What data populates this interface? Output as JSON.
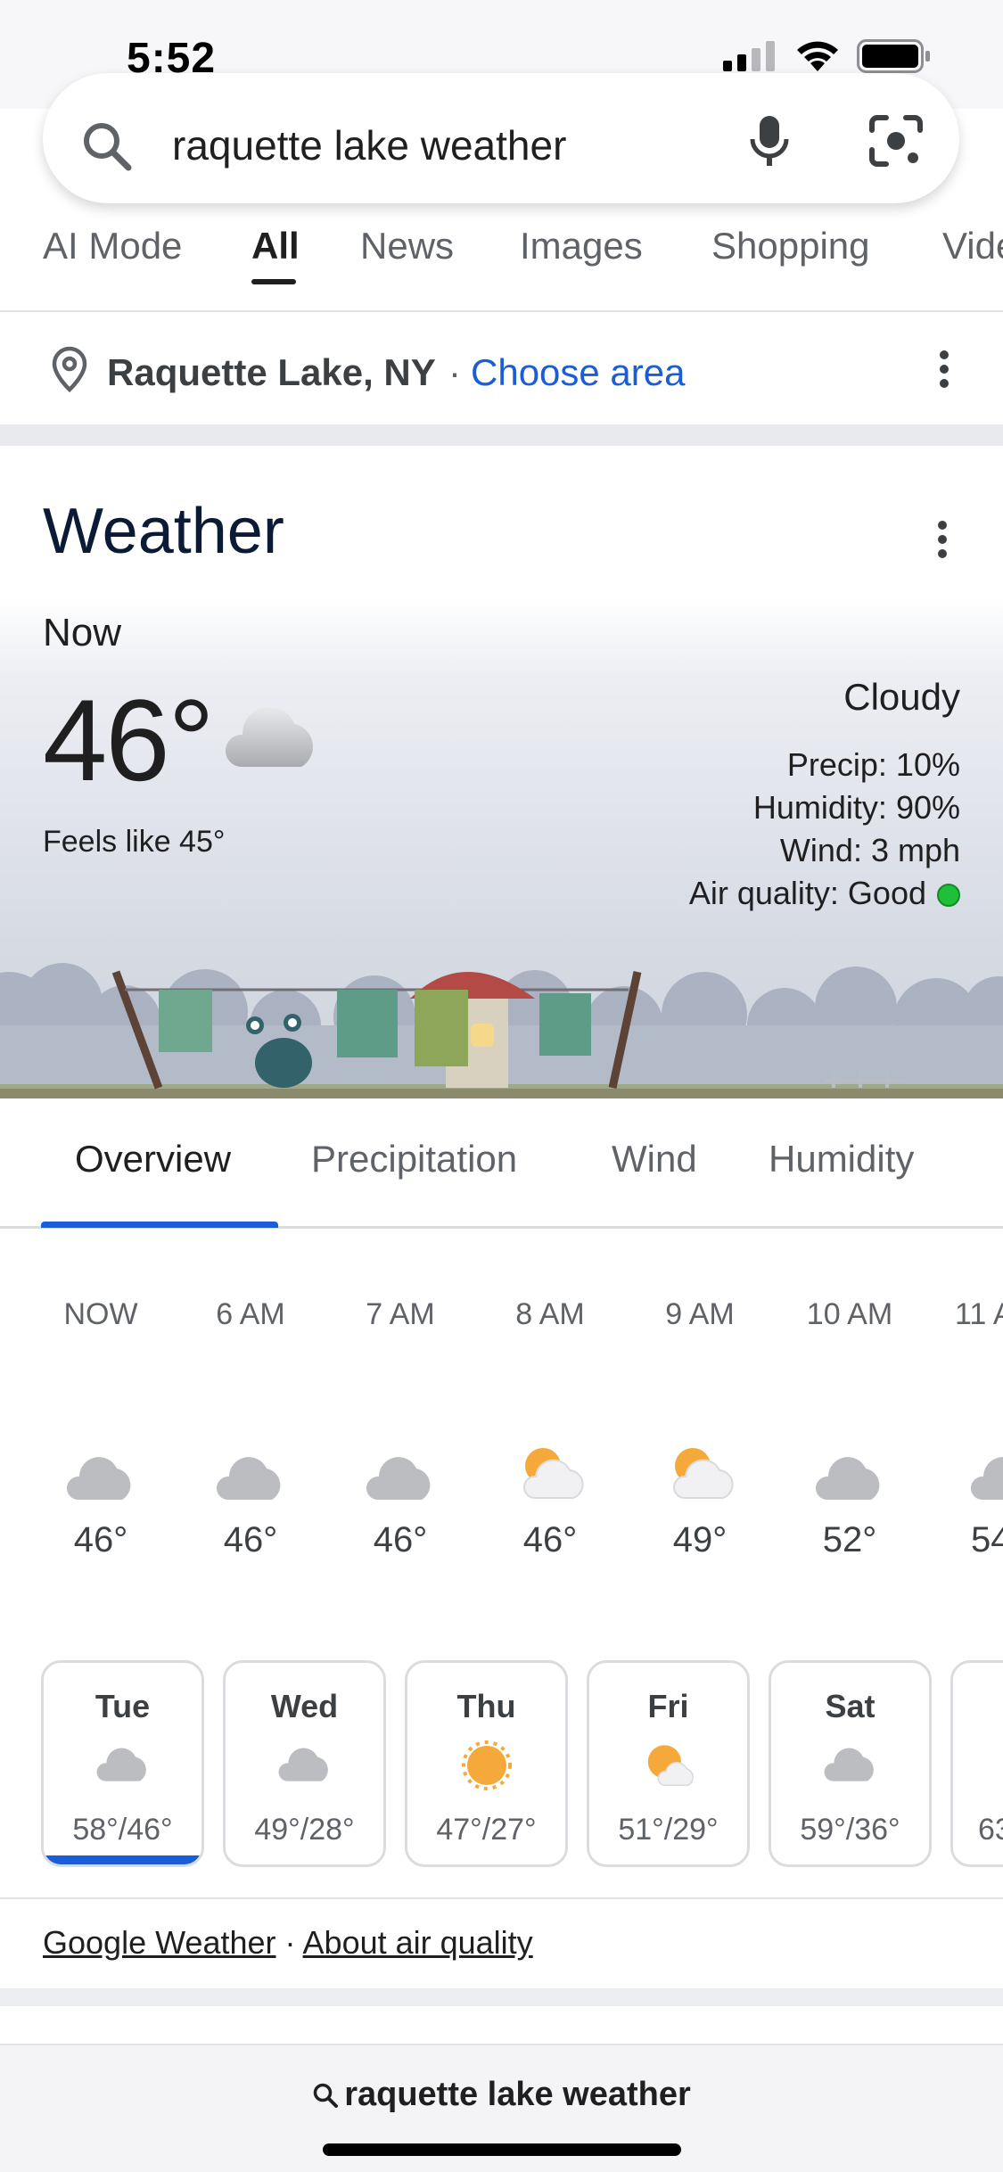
{
  "status": {
    "time": "5:52"
  },
  "search": {
    "query": "raquette lake weather"
  },
  "tabs": [
    {
      "label": "AI Mode"
    },
    {
      "label": "All"
    },
    {
      "label": "News"
    },
    {
      "label": "Images"
    },
    {
      "label": "Shopping"
    },
    {
      "label": "Vide"
    }
  ],
  "location": {
    "name": "Raquette Lake, NY",
    "separator": "·",
    "choose_area": "Choose area"
  },
  "weather": {
    "title": "Weather",
    "now_label": "Now",
    "temp": "46°",
    "feels_like": "Feels like 45°",
    "condition": "Cloudy",
    "precip": "Precip: 10%",
    "humidity": "Humidity: 90%",
    "wind": "Wind: 3 mph",
    "air_quality": "Air quality: Good",
    "air_quality_color": "#1fbf3a"
  },
  "weather_tabs": [
    {
      "label": "Overview"
    },
    {
      "label": "Precipitation"
    },
    {
      "label": "Wind"
    },
    {
      "label": "Humidity"
    }
  ],
  "hourly": [
    {
      "time": "NOW",
      "temp": "46°",
      "icon": "cloud-icon"
    },
    {
      "time": "6 AM",
      "temp": "46°",
      "icon": "cloud-icon"
    },
    {
      "time": "7 AM",
      "temp": "46°",
      "icon": "cloud-icon"
    },
    {
      "time": "8 AM",
      "temp": "46°",
      "icon": "partly-sunny-icon"
    },
    {
      "time": "9 AM",
      "temp": "49°",
      "icon": "partly-sunny-icon"
    },
    {
      "time": "10 AM",
      "temp": "52°",
      "icon": "cloud-icon"
    },
    {
      "time": "11 A",
      "temp": "54",
      "icon": "cloud-icon"
    }
  ],
  "daily": [
    {
      "day": "Tue",
      "range": "58°/46°",
      "icon": "cloud-icon"
    },
    {
      "day": "Wed",
      "range": "49°/28°",
      "icon": "cloud-icon"
    },
    {
      "day": "Thu",
      "range": "47°/27°",
      "icon": "sun-icon"
    },
    {
      "day": "Fri",
      "range": "51°/29°",
      "icon": "partly-sunny-icon"
    },
    {
      "day": "Sat",
      "range": "59°/36°",
      "icon": "cloud-icon"
    },
    {
      "day": "",
      "range": "63",
      "icon": ""
    }
  ],
  "footer": {
    "google_weather": "Google Weather",
    "dot": "·",
    "about_air_quality": "About air quality"
  },
  "bottom": {
    "query": "raquette lake weather"
  }
}
